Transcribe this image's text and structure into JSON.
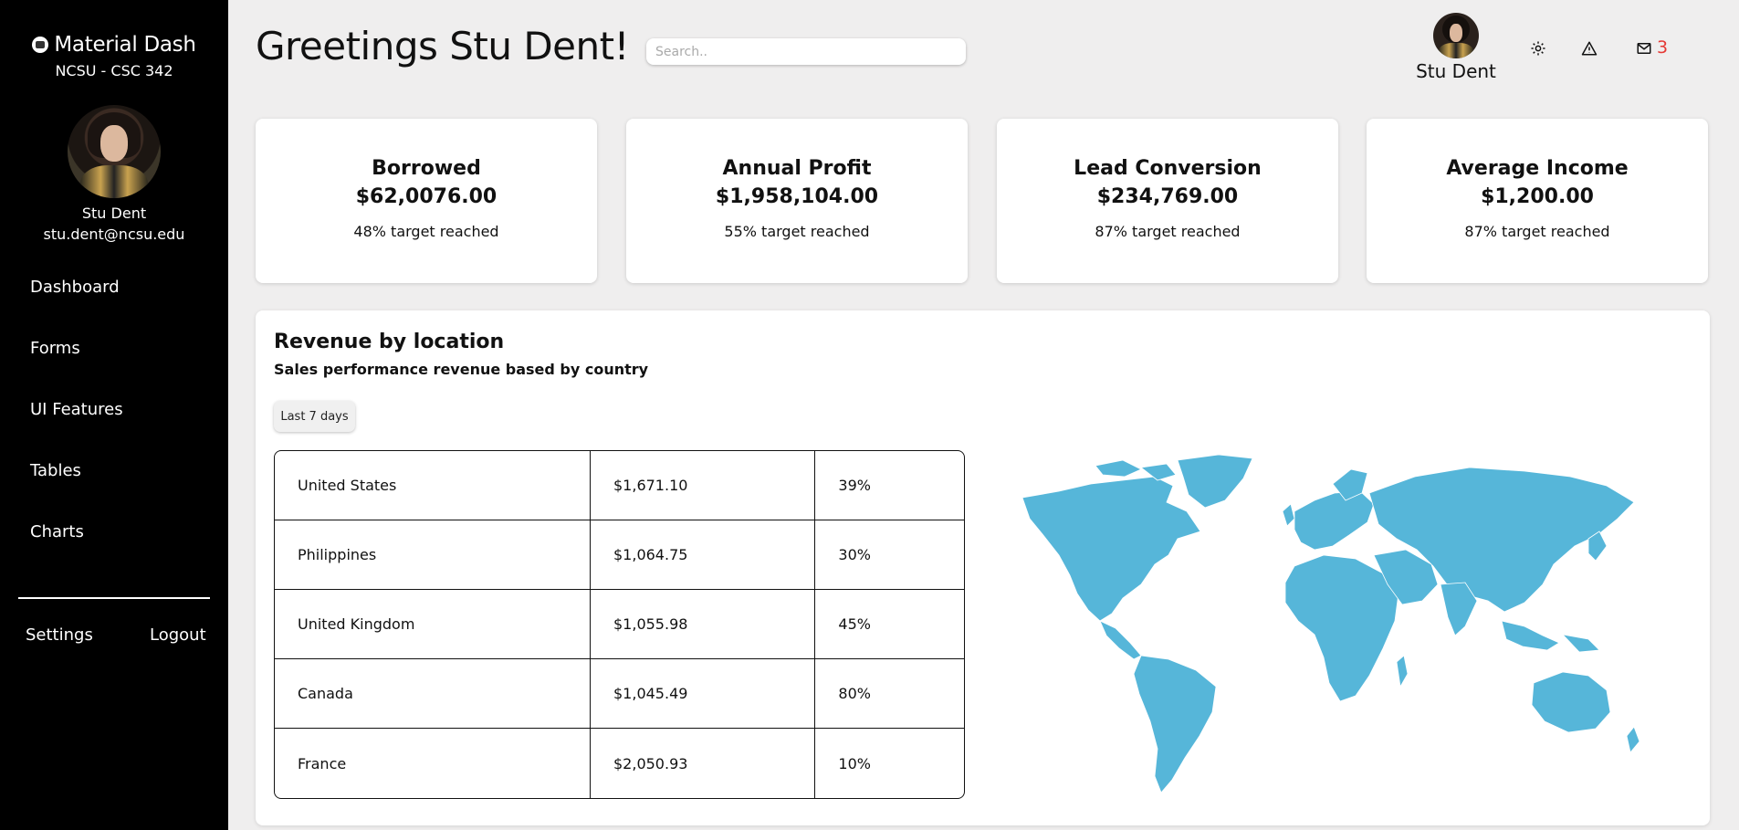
{
  "sidebar": {
    "brand": "Material Dash",
    "course": "NCSU - CSC 342",
    "user_name": "Stu Dent",
    "user_email": "stu.dent@ncsu.edu",
    "nav": [
      "Dashboard",
      "Forms",
      "UI Features",
      "Tables",
      "Charts"
    ],
    "settings": "Settings",
    "logout": "Logout"
  },
  "header": {
    "greeting": "Greetings Stu Dent!",
    "search_placeholder": "Search..",
    "user_name": "Stu Dent",
    "icons": [
      "gear-icon",
      "warning-icon",
      "mail-icon"
    ],
    "mail_count": "3",
    "mail_count_color": "#e53935"
  },
  "cards": [
    {
      "title": "Borrowed",
      "value": "$62,0076.00",
      "sub": "48% target reached"
    },
    {
      "title": "Annual Profit",
      "value": "$1,958,104.00",
      "sub": "55% target reached"
    },
    {
      "title": "Lead Conversion",
      "value": "$234,769.00",
      "sub": "87% target reached"
    },
    {
      "title": "Average Income",
      "value": "$1,200.00",
      "sub": "87% target reached"
    }
  ],
  "revenue": {
    "title": "Revenue by location",
    "subtitle": "Sales performance revenue based by country",
    "range_button": "Last 7 days",
    "rows": [
      {
        "country": "United States",
        "amount": "$1,671.10",
        "percent": "39%"
      },
      {
        "country": "Philippines",
        "amount": "$1,064.75",
        "percent": "30%"
      },
      {
        "country": "United Kingdom",
        "amount": "$1,055.98",
        "percent": "45%"
      },
      {
        "country": "Canada",
        "amount": "$1,045.49",
        "percent": "80%"
      },
      {
        "country": "France",
        "amount": "$2,050.93",
        "percent": "10%"
      }
    ],
    "map_color": "#56b6d9"
  }
}
